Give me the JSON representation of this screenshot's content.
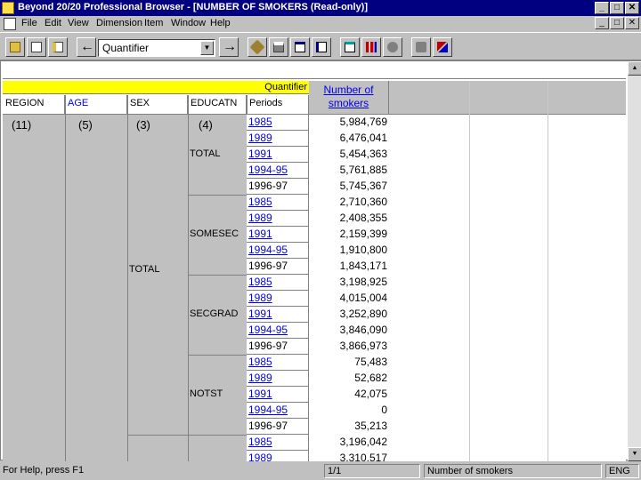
{
  "window": {
    "title": "Beyond 20/20 Professional Browser - [NUMBER OF SMOKERS (Read-only)]",
    "controls": [
      "_",
      "□",
      "✕"
    ]
  },
  "menu": [
    "File",
    "Edit",
    "View",
    "Dimension",
    "Item",
    "Window",
    "Help"
  ],
  "toolbar": {
    "quantifier_value": "Quantifier",
    "back_arrow": "←",
    "forward_arrow": "→",
    "dropdown_arrow": "▼"
  },
  "table": {
    "dim_bar_label": "Quantifier",
    "headers": [
      "REGION",
      "AGE",
      "SEX",
      "EDUCATN",
      "Periods"
    ],
    "header_link": [
      false,
      true,
      false,
      false,
      false
    ],
    "counts": [
      "(11)",
      "(5)",
      "(3)",
      "(4)"
    ],
    "measure_header": "Number of smokers",
    "sex_label": "TOTAL",
    "groups": [
      {
        "label": "TOTAL",
        "rows": [
          {
            "period": "1985",
            "value": "5,984,769",
            "link": true
          },
          {
            "period": "1989",
            "value": "6,476,041",
            "link": true
          },
          {
            "period": "1991",
            "value": "5,454,363",
            "link": true
          },
          {
            "period": "1994-95",
            "value": "5,761,885",
            "link": true
          },
          {
            "period": "1996-97",
            "value": "5,745,367",
            "link": false
          }
        ]
      },
      {
        "label": "SOMESEC",
        "rows": [
          {
            "period": "1985",
            "value": "2,710,360",
            "link": true
          },
          {
            "period": "1989",
            "value": "2,408,355",
            "link": true
          },
          {
            "period": "1991",
            "value": "2,159,399",
            "link": true
          },
          {
            "period": "1994-95",
            "value": "1,910,800",
            "link": true
          },
          {
            "period": "1996-97",
            "value": "1,843,171",
            "link": false
          }
        ]
      },
      {
        "label": "SECGRAD",
        "rows": [
          {
            "period": "1985",
            "value": "3,198,925",
            "link": true
          },
          {
            "period": "1989",
            "value": "4,015,004",
            "link": true
          },
          {
            "period": "1991",
            "value": "3,252,890",
            "link": true
          },
          {
            "period": "1994-95",
            "value": "3,846,090",
            "link": true
          },
          {
            "period": "1996-97",
            "value": "3,866,973",
            "link": false
          }
        ]
      },
      {
        "label": "NOTST",
        "rows": [
          {
            "period": "1985",
            "value": "75,483",
            "link": true
          },
          {
            "period": "1989",
            "value": "52,682",
            "link": true
          },
          {
            "period": "1991",
            "value": "42,075",
            "link": true
          },
          {
            "period": "1994-95",
            "value": "0",
            "link": true
          },
          {
            "period": "1996-97",
            "value": "35,213",
            "link": false
          }
        ]
      },
      {
        "label": "",
        "rows": [
          {
            "period": "1985",
            "value": "3,196,042",
            "link": true
          },
          {
            "period": "1989",
            "value": "3,310,517",
            "link": true
          }
        ]
      }
    ]
  },
  "status": {
    "help": "For Help, press F1",
    "page": "1/1",
    "measure": "Number of smokers",
    "lang": "ENG"
  }
}
